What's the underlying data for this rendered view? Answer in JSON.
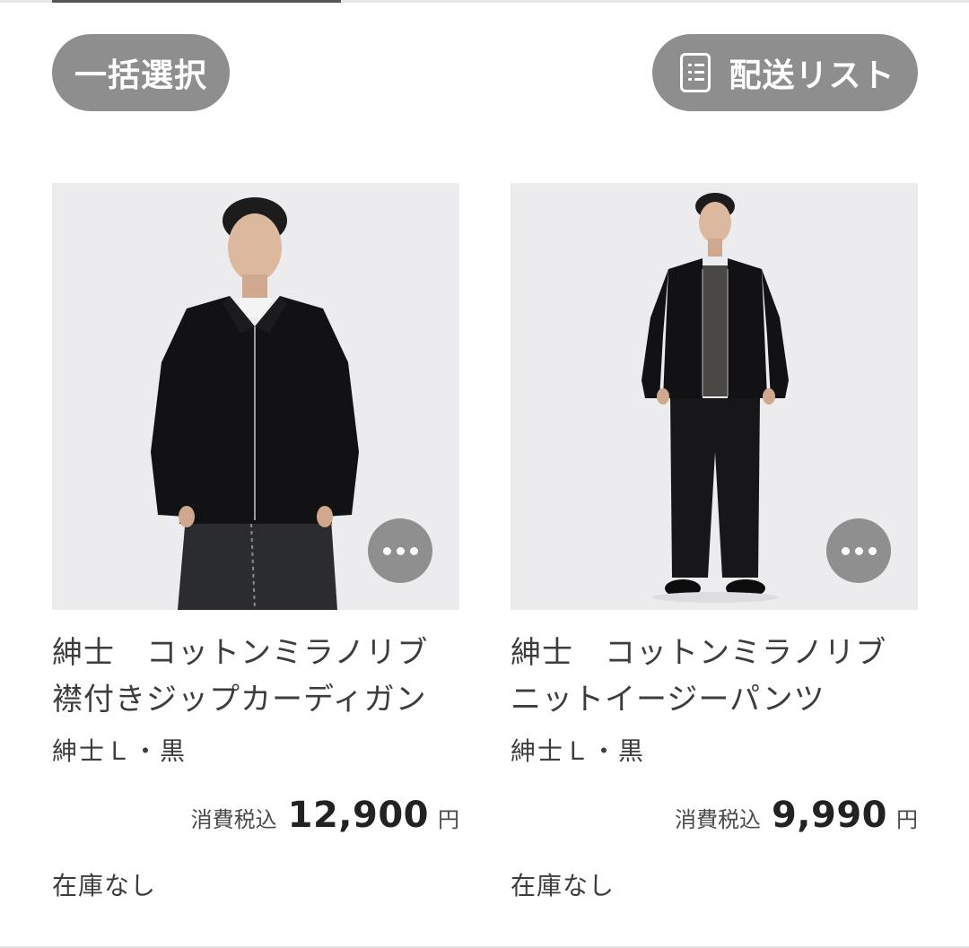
{
  "toolbar": {
    "select_all_label": "一括選択",
    "delivery_list_label": "配送リスト",
    "delivery_list_icon": "list-document-icon"
  },
  "colors": {
    "pill_bg": "#8e8e8e",
    "photo_bg": "#ecebee",
    "text": "#3d3d3d"
  },
  "products": [
    {
      "name_line1": "紳士　コットンミラノリブ",
      "name_line2": "襟付きジップカーディガン",
      "variant": "紳士Ｌ・黒",
      "tax_label": "消費税込",
      "price": "12,900",
      "currency": "円",
      "stock": "在庫なし",
      "more_icon": "more-horizontal-icon"
    },
    {
      "name_line1": "紳士　コットンミラノリブ",
      "name_line2": "ニットイージーパンツ",
      "variant": "紳士Ｌ・黒",
      "tax_label": "消費税込",
      "price": "9,990",
      "currency": "円",
      "stock": "在庫なし",
      "more_icon": "more-horizontal-icon"
    }
  ]
}
